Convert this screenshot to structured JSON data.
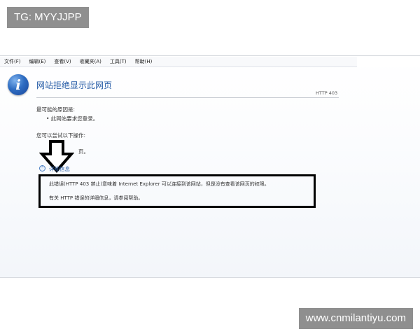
{
  "watermarks": {
    "top": "TG: MYYJJPP",
    "bottom": "www.cnmilantiyu.com"
  },
  "menubar": {
    "items": [
      "文件(F)",
      "编辑(E)",
      "查看(V)",
      "收藏夹(A)",
      "工具(T)",
      "帮助(H)"
    ]
  },
  "page": {
    "icon": "info-icon",
    "icon_glyph": "i",
    "title": "网站拒绝显示此网页",
    "http_code": "HTTP 403",
    "cause_heading": "最可能的原因是:",
    "cause_bullet": "• 此网站要求您登录。",
    "try_heading": "您可以尝试以下操作:",
    "back_link_fragment": "页。",
    "details_toggle_glyph": "⌃",
    "details_link": "详细信息",
    "details_line1": "此错误(HTTP 403 禁止)意味着 Internet Explorer 可以连接到该网站，但是没有查看该网页的权限。",
    "details_line2": "有关 HTTP 错误的详细信息，请参阅帮助。"
  }
}
